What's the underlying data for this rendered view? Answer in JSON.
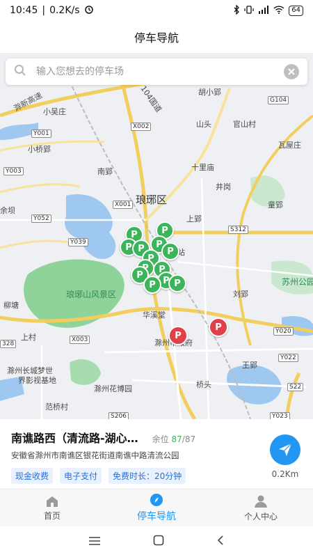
{
  "status_bar": {
    "time": "10:45",
    "network_speed": "0.2K/s",
    "battery": "64"
  },
  "header": {
    "title": "停车导航"
  },
  "search": {
    "placeholder": "输入您想去的停车场"
  },
  "map": {
    "labels": {
      "langya_district": "琅琊区",
      "chuxin_expressway": "滁新高速",
      "national_road": "104国道",
      "huzi": "胡小郢",
      "xiaowu": "小吴庄",
      "xiaoqiao": "小桥郢",
      "shanzhi": "山头",
      "guanshan": "官山村",
      "walu": "瓦屋庄",
      "shilimiao": "十里庙",
      "nanying": "南郢",
      "jinggang": "井岗",
      "tongying": "童郢",
      "shangying": "上郢",
      "yujiaba": "余坝",
      "langyashan": "琅琊山风景区",
      "liutang": "柳塘",
      "huaxitang": "华溪堂",
      "chuzhou_gov": "滁州市政府",
      "liuying": "刘郢",
      "suzhou_park": "苏州公园",
      "changcheng_1": "滁州长城梦世",
      "changcheng_2": "界影视基地",
      "huabo": "滁州花博园",
      "shangcun": "上村",
      "wangying": "王郢",
      "qiaotou": "桥头",
      "fanqiao": "范桥村",
      "zhan": "站"
    },
    "roads": [
      "Y001",
      "Y003",
      "Y052",
      "Y039",
      "X002",
      "X001",
      "X003",
      "S312",
      "G104",
      "Y020",
      "Y022",
      "S22",
      "S206",
      "Y023",
      "328"
    ]
  },
  "parking": {
    "name": "南谯路西（清流路-湖心…",
    "remaining_label": "余位",
    "remaining_available": "87",
    "remaining_total": "/87",
    "address": "安徽省滁州市南谯区银花街道南谯中路清流公园",
    "tags": [
      "现金收费",
      "电子支付",
      "免费时长：20分钟"
    ],
    "distance": "0.2Km"
  },
  "tabs": [
    {
      "label": "首页",
      "icon": "home-icon",
      "active": false
    },
    {
      "label": "停车导航",
      "icon": "compass-icon",
      "active": true
    },
    {
      "label": "个人中心",
      "icon": "user-icon",
      "active": false
    }
  ],
  "colors": {
    "accent": "#2196f3",
    "pin_green": "#3cb55a",
    "pin_red": "#e0404a",
    "water": "#9fc8f0",
    "park": "#8fd39b",
    "road": "#f5d76e"
  }
}
